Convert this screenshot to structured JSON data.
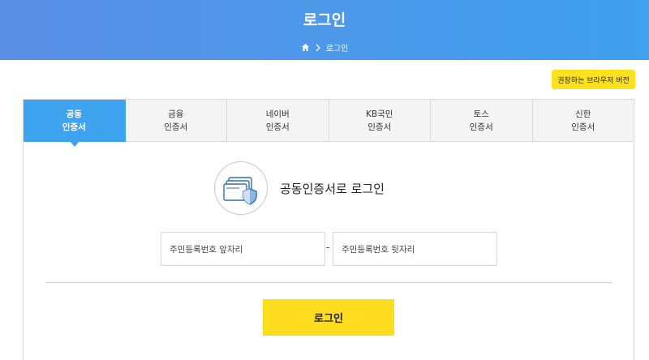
{
  "header": {
    "title": "로그인",
    "breadcrumb": {
      "home_icon": "home-icon",
      "separator_icon": "chevron-right-icon",
      "current": "로그인"
    }
  },
  "browser_button": {
    "label": "권장하는 브라우저 버전"
  },
  "tabs": [
    {
      "line1": "공동",
      "line2": "인증서",
      "active": true
    },
    {
      "line1": "금융",
      "line2": "인증서",
      "active": false
    },
    {
      "line1": "네이버",
      "line2": "인증서",
      "active": false
    },
    {
      "line1": "KB국민",
      "line2": "인증서",
      "active": false
    },
    {
      "line1": "토스",
      "line2": "인증서",
      "active": false
    },
    {
      "line1": "신한",
      "line2": "인증서",
      "active": false
    }
  ],
  "cert": {
    "icon": "certificate-shield-icon",
    "title": "공동인증서로 로그인"
  },
  "form": {
    "front": {
      "placeholder": "주민등록번호 앞자리"
    },
    "separator": "-",
    "back": {
      "placeholder": "주민등록번호 뒷자리"
    }
  },
  "login_button": {
    "label": "로그인"
  },
  "colors": {
    "accent": "#3ea4f0",
    "header_start": "#5b8fe6",
    "header_end": "#3fa1ef",
    "button": "#ffdc1f"
  }
}
